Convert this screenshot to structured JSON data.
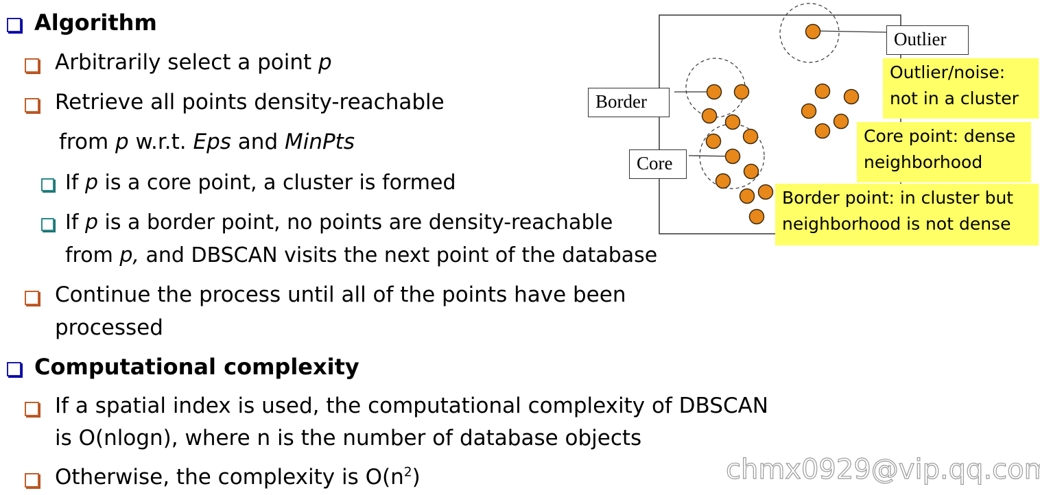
{
  "slide": {
    "sections": [
      {
        "heading": "Algorithm",
        "items": [
          {
            "pre": "Arbitrarily select a point ",
            "var": "p"
          },
          {
            "line1": "Retrieve all points density-reachable",
            "line2_pre": "from ",
            "line2_var1": "p",
            "line2_mid": " w.r.t. ",
            "line2_var2": "Eps",
            "line2_and": " and ",
            "line2_var3": "MinPts"
          },
          {
            "sub": true,
            "pre": "If ",
            "var": "p",
            "post": " is a core point, a cluster is formed"
          },
          {
            "sub": true,
            "pre": "If ",
            "var": "p",
            "post": " is a border point, no points are density-reachable",
            "line2_pre": "from ",
            "line2_var": "p,",
            "line2_post": " and DBSCAN visits the next point of the database"
          },
          {
            "line1": "Continue the process until all of the points have been",
            "line2": "processed"
          }
        ]
      },
      {
        "heading": "Computational complexity",
        "items": [
          {
            "line1": "If a spatial index is used, the computational complexity of DBSCAN",
            "line2": "is O(nlogn), where n is the number of database objects"
          },
          {
            "pre": "Otherwise, the complexity is O(n",
            "sup": "2",
            "post": ")"
          }
        ]
      }
    ]
  },
  "diagram": {
    "labels": {
      "outlier": "Outlier",
      "border": "Border",
      "core": "Core"
    },
    "notes": {
      "outlier_line1": "Outlier/noise:",
      "outlier_line2": "not in a cluster",
      "core_line1": "Core point: dense",
      "core_line2": "neighborhood",
      "border_line1": "Border point: in cluster but",
      "border_line2": "neighborhood is not dense"
    },
    "point_color": "#e8881a",
    "note_color": "#ffff66"
  },
  "watermark": "chmx0929@vip.qq.com"
}
